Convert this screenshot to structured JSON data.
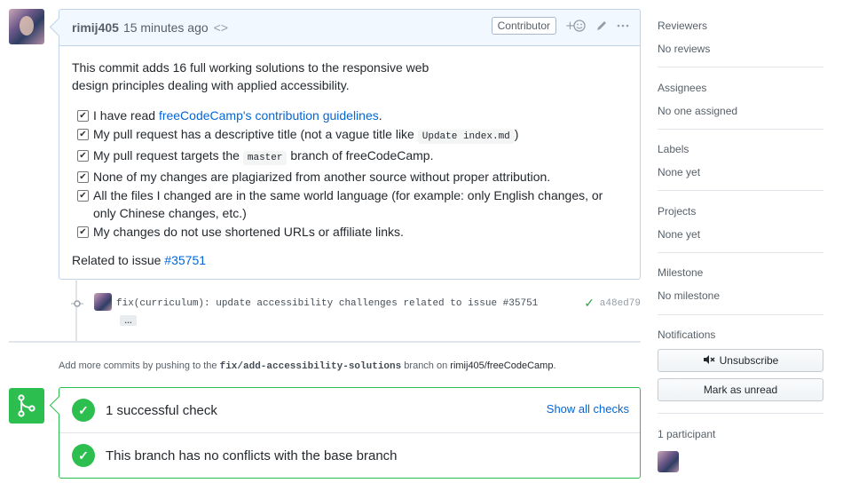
{
  "comment": {
    "author": "rimij405",
    "time": "15 minutes ago",
    "badge": "Contributor",
    "intro": "This commit adds 16 full working solutions to the responsive web design principles dealing with applied accessibility.",
    "tasks": {
      "t1_pre": "I have read ",
      "t1_link": "freeCodeCamp's contribution guidelines",
      "t1_post": ".",
      "t2_pre": "My pull request has a descriptive title (not a vague title like ",
      "t2_code": "Update index.md",
      "t2_post": ")",
      "t3_pre": "My pull request targets the ",
      "t3_code": "master",
      "t3_post": " branch of freeCodeCamp.",
      "t4": "None of my changes are plagiarized from another source without proper attribution.",
      "t5": "All the files I changed are in the same world language (for example: only English changes, or only Chinese changes, etc.)",
      "t6": "My changes do not use shortened URLs or affiliate links."
    },
    "related_text": "Related to issue ",
    "related_issue": "#35751"
  },
  "commit": {
    "message": "fix(curriculum): update accessibility challenges related to issue #35751",
    "ellipsis": "…",
    "sha": "a48ed79"
  },
  "push_note": {
    "pre": "Add more commits by pushing to the ",
    "branch": "fix/add-accessibility-solutions",
    "mid": " branch on ",
    "repo": "rimij405/freeCodeCamp",
    "post": "."
  },
  "merge": {
    "checks_title": "1 successful check",
    "show_all": "Show all checks",
    "conflicts_title": "This branch has no conflicts with the base branch"
  },
  "sidebar": {
    "reviewers": {
      "title": "Reviewers",
      "value": "No reviews"
    },
    "assignees": {
      "title": "Assignees",
      "value": "No one assigned"
    },
    "labels": {
      "title": "Labels",
      "value": "None yet"
    },
    "projects": {
      "title": "Projects",
      "value": "None yet"
    },
    "milestone": {
      "title": "Milestone",
      "value": "No milestone"
    },
    "notifications": {
      "title": "Notifications",
      "unsubscribe": "Unsubscribe",
      "mark_unread": "Mark as unread"
    },
    "participants": {
      "title": "1 participant"
    }
  },
  "icons": {
    "mute": "mute-icon",
    "smiley": "add-reaction-icon",
    "pencil": "edit-icon",
    "kebab": "more-icon",
    "check": "check-icon",
    "merge": "merge-icon",
    "commit": "commit-icon",
    "code": "code-icon"
  },
  "colors": {
    "success": "#2cbe4e",
    "link": "#0366d6",
    "header_bg": "#f1f8ff",
    "border": "#c0d3eb"
  }
}
